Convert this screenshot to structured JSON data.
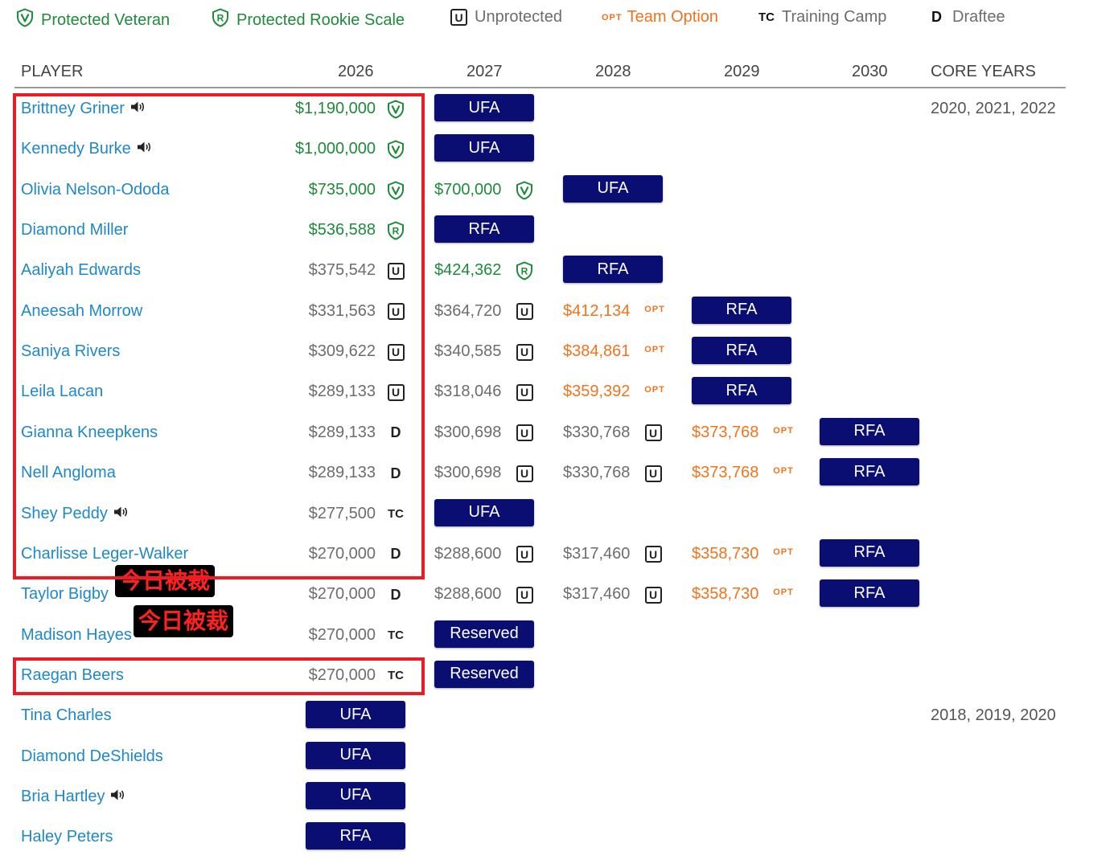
{
  "legend": {
    "protected_veteran": "Protected Veteran",
    "protected_rookie": "Protected Rookie Scale",
    "unprotected_tag": "U",
    "unprotected": "Unprotected",
    "team_option_tag": "OPT",
    "team_option": "Team Option",
    "training_camp_tag": "TC",
    "training_camp": "Training Camp",
    "draftee_tag": "D",
    "draftee": "Draftee"
  },
  "header": {
    "player": "PLAYER",
    "y2026": "2026",
    "y2027": "2027",
    "y2028": "2028",
    "y2029": "2029",
    "y2030": "2030",
    "core_years": "CORE YEARS"
  },
  "colors": {
    "protected_green": "#1f8a3a",
    "unprotected_grey": "#6d6d6d",
    "option_orange": "#f2731c",
    "link_blue": "#1e88c8",
    "pill_navy": "#0a0e73",
    "highlight_red": "#ee1b24"
  },
  "icons": {
    "veteran": "shield-v-icon",
    "rookie": "shield-r-icon",
    "audio": "speaker-icon"
  },
  "badges": {
    "unprotected": "U",
    "draftee": "D",
    "training_camp": "TC",
    "option": "OPT"
  },
  "annotations": {
    "cut_today": "今日被裁"
  },
  "rows": [
    {
      "name": "Brittney Griner",
      "audio": true,
      "core": "2020, 2021, 2022",
      "y2026": {
        "amount": "$1,190,000",
        "color": "green",
        "mark": "V"
      },
      "y2027": {
        "pill": "UFA"
      }
    },
    {
      "name": "Kennedy Burke",
      "audio": true,
      "y2026": {
        "amount": "$1,000,000",
        "color": "green",
        "mark": "V"
      },
      "y2027": {
        "pill": "UFA"
      }
    },
    {
      "name": "Olivia Nelson-Ododa",
      "y2026": {
        "amount": "$735,000",
        "color": "green",
        "mark": "V"
      },
      "y2027": {
        "amount": "$700,000",
        "color": "green",
        "mark": "V"
      },
      "y2028": {
        "pill": "UFA"
      }
    },
    {
      "name": "Diamond Miller",
      "y2026": {
        "amount": "$536,588",
        "color": "green",
        "mark": "R"
      },
      "y2027": {
        "pill": "RFA"
      }
    },
    {
      "name": "Aaliyah Edwards",
      "y2026": {
        "amount": "$375,542",
        "color": "grey",
        "mark": "U"
      },
      "y2027": {
        "amount": "$424,362",
        "color": "green",
        "mark": "R"
      },
      "y2028": {
        "pill": "RFA"
      }
    },
    {
      "name": "Aneesah Morrow",
      "y2026": {
        "amount": "$331,563",
        "color": "grey",
        "mark": "U"
      },
      "y2027": {
        "amount": "$364,720",
        "color": "grey",
        "mark": "U"
      },
      "y2028": {
        "amount": "$412,134",
        "color": "orange",
        "mark": "OPT"
      },
      "y2029": {
        "pill": "RFA"
      }
    },
    {
      "name": "Saniya Rivers",
      "y2026": {
        "amount": "$309,622",
        "color": "grey",
        "mark": "U"
      },
      "y2027": {
        "amount": "$340,585",
        "color": "grey",
        "mark": "U"
      },
      "y2028": {
        "amount": "$384,861",
        "color": "orange",
        "mark": "OPT"
      },
      "y2029": {
        "pill": "RFA"
      }
    },
    {
      "name": "Leila Lacan",
      "y2026": {
        "amount": "$289,133",
        "color": "grey",
        "mark": "U"
      },
      "y2027": {
        "amount": "$318,046",
        "color": "grey",
        "mark": "U"
      },
      "y2028": {
        "amount": "$359,392",
        "color": "orange",
        "mark": "OPT"
      },
      "y2029": {
        "pill": "RFA"
      }
    },
    {
      "name": "Gianna Kneepkens",
      "y2026": {
        "amount": "$289,133",
        "color": "grey",
        "mark": "D"
      },
      "y2027": {
        "amount": "$300,698",
        "color": "grey",
        "mark": "U"
      },
      "y2028": {
        "amount": "$330,768",
        "color": "grey",
        "mark": "U"
      },
      "y2029": {
        "amount": "$373,768",
        "color": "orange",
        "mark": "OPT"
      },
      "y2030": {
        "pill": "RFA"
      }
    },
    {
      "name": "Nell Angloma",
      "y2026": {
        "amount": "$289,133",
        "color": "grey",
        "mark": "D"
      },
      "y2027": {
        "amount": "$300,698",
        "color": "grey",
        "mark": "U"
      },
      "y2028": {
        "amount": "$330,768",
        "color": "grey",
        "mark": "U"
      },
      "y2029": {
        "amount": "$373,768",
        "color": "orange",
        "mark": "OPT"
      },
      "y2030": {
        "pill": "RFA"
      }
    },
    {
      "name": "Shey Peddy",
      "audio": true,
      "y2026": {
        "amount": "$277,500",
        "color": "grey",
        "mark": "TC"
      },
      "y2027": {
        "pill": "UFA"
      }
    },
    {
      "name": "Charlisse Leger-Walker",
      "y2026": {
        "amount": "$270,000",
        "color": "grey",
        "mark": "D"
      },
      "y2027": {
        "amount": "$288,600",
        "color": "grey",
        "mark": "U"
      },
      "y2028": {
        "amount": "$317,460",
        "color": "grey",
        "mark": "U"
      },
      "y2029": {
        "amount": "$358,730",
        "color": "orange",
        "mark": "OPT"
      },
      "y2030": {
        "pill": "RFA"
      }
    },
    {
      "name": "Taylor Bigby",
      "stamp": true,
      "y2026": {
        "amount": "$270,000",
        "color": "grey",
        "mark": "D"
      },
      "y2027": {
        "amount": "$288,600",
        "color": "grey",
        "mark": "U"
      },
      "y2028": {
        "amount": "$317,460",
        "color": "grey",
        "mark": "U"
      },
      "y2029": {
        "amount": "$358,730",
        "color": "orange",
        "mark": "OPT"
      },
      "y2030": {
        "pill": "RFA"
      }
    },
    {
      "name": "Madison Hayes",
      "stamp": true,
      "y2026": {
        "amount": "$270,000",
        "color": "grey",
        "mark": "TC"
      },
      "y2027": {
        "pill": "Reserved"
      }
    },
    {
      "name": "Raegan Beers",
      "y2026": {
        "amount": "$270,000",
        "color": "grey",
        "mark": "TC"
      },
      "y2027": {
        "pill": "Reserved"
      }
    },
    {
      "name": "Tina Charles",
      "core": "2018, 2019, 2020",
      "y2026": {
        "pill": "UFA"
      }
    },
    {
      "name": "Diamond DeShields",
      "y2026": {
        "pill": "UFA"
      }
    },
    {
      "name": "Bria Hartley",
      "audio": true,
      "y2026": {
        "pill": "UFA"
      }
    },
    {
      "name": "Haley Peters",
      "y2026": {
        "pill": "RFA"
      }
    }
  ]
}
